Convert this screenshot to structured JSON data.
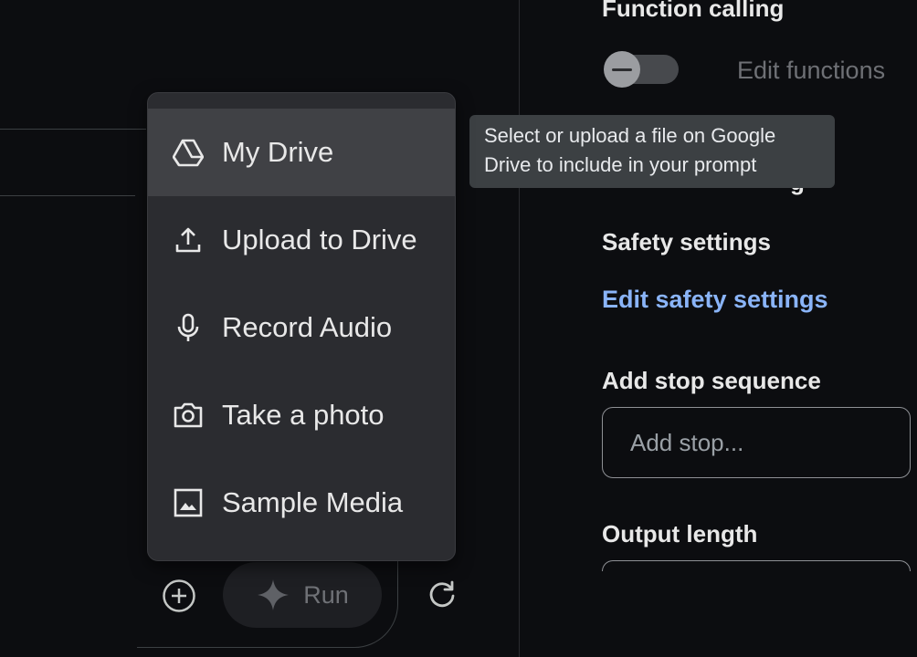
{
  "run_panel": {
    "add_icon": "plus-circle-icon",
    "run_label": "Run",
    "run_icon": "sparkle-icon",
    "refresh_icon": "refresh-icon"
  },
  "settings": {
    "function_calling": {
      "title": "Function calling",
      "toggle_on": false,
      "edit_label": "Edit functions"
    },
    "hidden_title_fragment": "g",
    "safety": {
      "title": "Safety settings",
      "link": "Edit safety settings"
    },
    "stop_sequence": {
      "title": "Add stop sequence",
      "placeholder": "Add stop..."
    },
    "output_length": {
      "title": "Output length"
    }
  },
  "tooltip": {
    "text": "Select or upload a file on Google Drive to include in your prompt"
  },
  "menu": {
    "items": [
      {
        "label": "My Drive",
        "icon": "google-drive-icon",
        "active": true
      },
      {
        "label": "Upload to Drive",
        "icon": "upload-icon",
        "active": false
      },
      {
        "label": "Record Audio",
        "icon": "microphone-icon",
        "active": false
      },
      {
        "label": "Take a photo",
        "icon": "camera-icon",
        "active": false
      },
      {
        "label": "Sample Media",
        "icon": "image-icon",
        "active": false
      }
    ]
  },
  "colors": {
    "background": "#0c0d10",
    "menu_bg": "#2b2c30",
    "menu_active": "#404145",
    "link": "#8ab4f8",
    "tooltip_bg": "#3c4043"
  }
}
